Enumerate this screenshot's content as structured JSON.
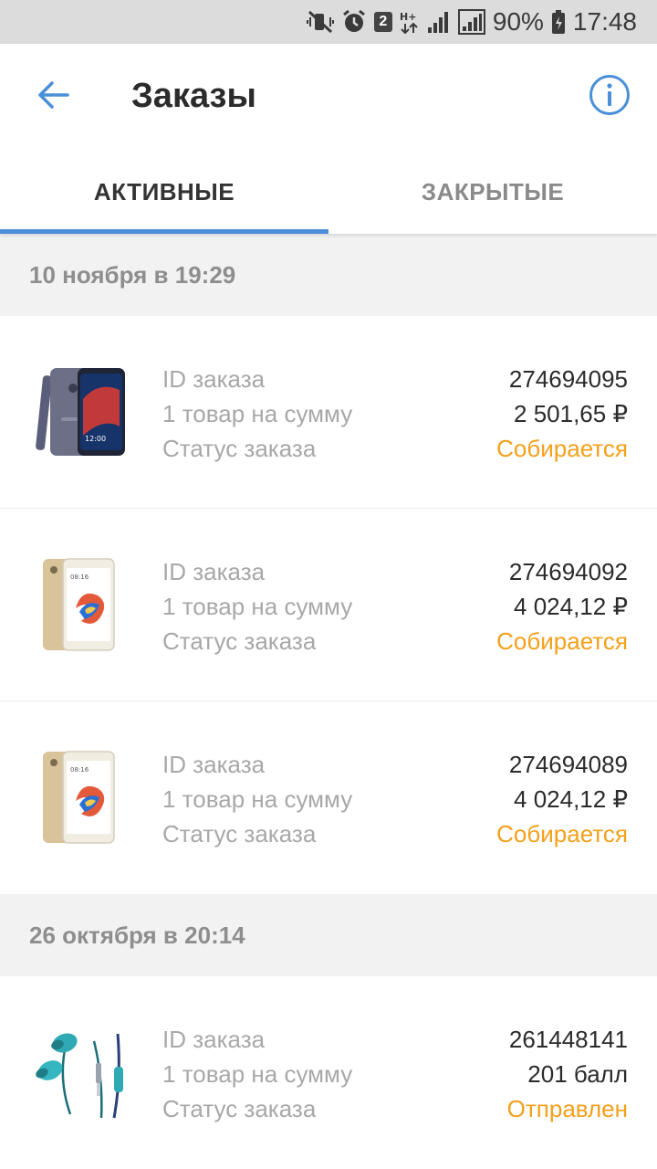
{
  "statusbar": {
    "sim_badge": "2",
    "network": "H+",
    "battery": "90%",
    "time": "17:48"
  },
  "appbar": {
    "title": "Заказы"
  },
  "tabs": [
    {
      "label": "АКТИВНЫЕ",
      "active": true
    },
    {
      "label": "ЗАКРЫТЫЕ",
      "active": false
    }
  ],
  "labels": {
    "order_id": "ID заказа",
    "items_sum": "1 товар на сумму",
    "status": "Статус заказа"
  },
  "groups": [
    {
      "date": "10 ноября в 19:29",
      "orders": [
        {
          "id": "274694095",
          "sum": "2 501,65 ₽",
          "status": "Собирается",
          "image": "dark-phone-image"
        },
        {
          "id": "274694092",
          "sum": "4 024,12 ₽",
          "status": "Собирается",
          "image": "gold-phone-image"
        },
        {
          "id": "274694089",
          "sum": "4 024,12 ₽",
          "status": "Собирается",
          "image": "gold-phone-image"
        }
      ]
    },
    {
      "date": "26 октября в 20:14",
      "orders": [
        {
          "id": "261448141",
          "sum": "201 балл",
          "status": "Отправлен",
          "image": "earphones-image"
        }
      ]
    }
  ],
  "colors": {
    "accent": "#4a8fd8",
    "status": "#f4a01b"
  }
}
